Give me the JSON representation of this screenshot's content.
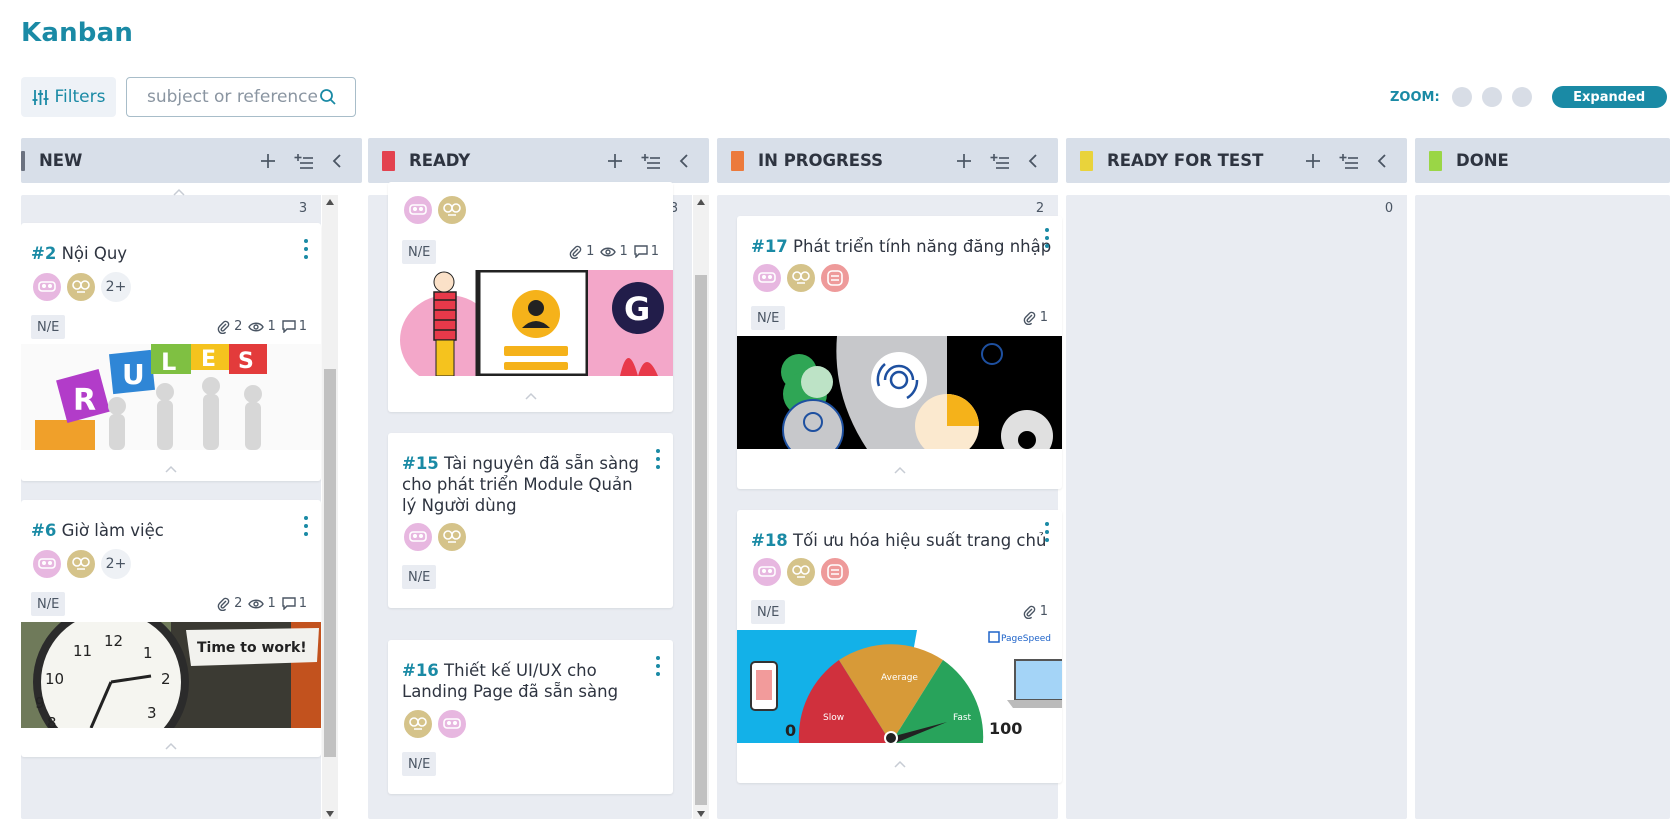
{
  "page": {
    "title": "Kanban"
  },
  "toolbar": {
    "filters_label": "Filters",
    "search_placeholder": "subject or reference",
    "zoom_label": "ZOOM:",
    "zoom_selected": "Expanded"
  },
  "columns": [
    {
      "title": "NEW",
      "color": "#6b7280",
      "count": "3"
    },
    {
      "title": "READY",
      "color": "#e3424f",
      "count": "3"
    },
    {
      "title": "IN PROGRESS",
      "color": "#ec7a3b",
      "count": "2"
    },
    {
      "title": "READY FOR TEST",
      "color": "#e9d33b",
      "count": "0"
    },
    {
      "title": "DONE",
      "color": "#9ad646"
    }
  ],
  "cards": {
    "new_2": {
      "ref": "#2",
      "subject": "Nội Quy",
      "more": "2+",
      "tag": "N/E",
      "attachments": "2",
      "watchers": "1",
      "comments": "1"
    },
    "new_6": {
      "ref": "#6",
      "subject": "Giờ làm việc",
      "more": "2+",
      "tag": "N/E",
      "attachments": "2",
      "watchers": "1",
      "comments": "1",
      "image_text": "Time to work!"
    },
    "ready_top": {
      "tag": "N/E",
      "attachments": "1",
      "watchers": "1",
      "comments": "1"
    },
    "ready_15": {
      "ref": "#15",
      "subject": "Tài nguyên đã sẵn sàng cho phát triển Module Quản lý Người dùng",
      "tag": "N/E"
    },
    "ready_16": {
      "ref": "#16",
      "subject": "Thiết kế UI/UX cho Landing Page đã sẵn sàng",
      "tag": "N/E"
    },
    "prog_17": {
      "ref": "#17",
      "subject": "Phát triển tính năng đăng nhập",
      "tag": "N/E",
      "attachments": "1"
    },
    "prog_18": {
      "ref": "#18",
      "subject": "Tối ưu hóa hiệu suất trang chủ",
      "tag": "N/E",
      "attachments": "1",
      "gauge": {
        "brand": "PageSpeed",
        "min": "0",
        "max": "100",
        "slow": "Slow",
        "average": "Average",
        "fast": "Fast"
      }
    }
  }
}
